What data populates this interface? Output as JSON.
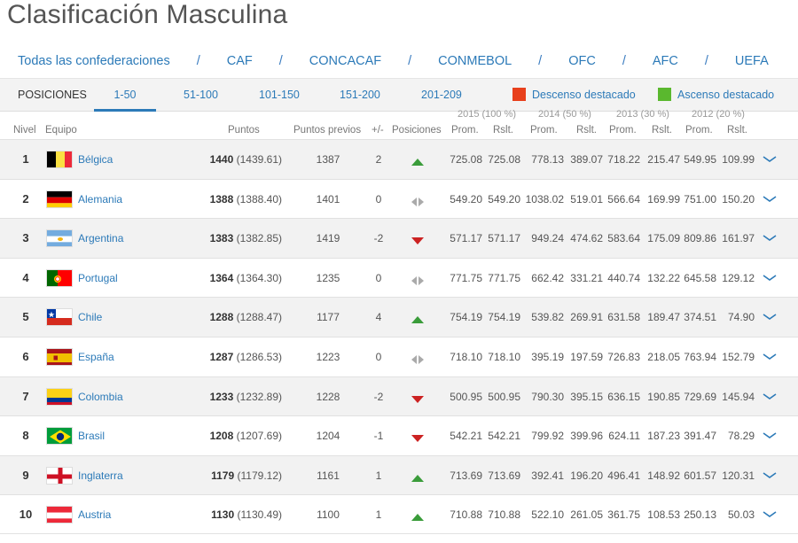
{
  "title": "Clasificación Masculina",
  "confederations": [
    "Todas las confederaciones",
    "CAF",
    "CONCACAF",
    "CONMEBOL",
    "OFC",
    "AFC",
    "UEFA"
  ],
  "confederation_separator": "/",
  "tabs": {
    "label": "POSICIONES",
    "ranges": [
      "1-50",
      "51-100",
      "101-150",
      "151-200",
      "201-209"
    ],
    "active": "1-50"
  },
  "legend": [
    {
      "label": "Descenso destacado",
      "color": "#e8401c"
    },
    {
      "label": "Ascenso destacado",
      "color": "#5ab82e"
    }
  ],
  "colors": {
    "accent": "#2c7ab8",
    "up": "#3a9c3a",
    "down": "#cc2222",
    "same": "#aaaaaa"
  },
  "year_headers": [
    "2015 (100 %)",
    "2014 (50 %)",
    "2013 (30 %)",
    "2012 (20 %)"
  ],
  "columns": {
    "nivel": "Nivel",
    "equipo": "Equipo",
    "puntos": "Puntos",
    "previos": "Puntos previos",
    "diff": "+/-",
    "posiciones": "Posiciones",
    "prom": "Prom.",
    "rslt": "Rslt."
  },
  "rows": [
    {
      "rank": "1",
      "team": "Bélgica",
      "flag": "belgium-flag",
      "pts": "1440",
      "pts_exact": "(1439.61)",
      "prev": "1387",
      "diff": "2",
      "trend": "up",
      "y2015": [
        "725.08",
        "725.08"
      ],
      "y2014": [
        "778.13",
        "389.07"
      ],
      "y2013": [
        "718.22",
        "215.47"
      ],
      "y2012": [
        "549.95",
        "109.99"
      ]
    },
    {
      "rank": "2",
      "team": "Alemania",
      "flag": "germany-flag",
      "pts": "1388",
      "pts_exact": "(1388.40)",
      "prev": "1401",
      "diff": "0",
      "trend": "same",
      "y2015": [
        "549.20",
        "549.20"
      ],
      "y2014": [
        "1038.02",
        "519.01"
      ],
      "y2013": [
        "566.64",
        "169.99"
      ],
      "y2012": [
        "751.00",
        "150.20"
      ]
    },
    {
      "rank": "3",
      "team": "Argentina",
      "flag": "argentina-flag",
      "pts": "1383",
      "pts_exact": "(1382.85)",
      "prev": "1419",
      "diff": "-2",
      "trend": "down",
      "y2015": [
        "571.17",
        "571.17"
      ],
      "y2014": [
        "949.24",
        "474.62"
      ],
      "y2013": [
        "583.64",
        "175.09"
      ],
      "y2012": [
        "809.86",
        "161.97"
      ]
    },
    {
      "rank": "4",
      "team": "Portugal",
      "flag": "portugal-flag",
      "pts": "1364",
      "pts_exact": "(1364.30)",
      "prev": "1235",
      "diff": "0",
      "trend": "same",
      "y2015": [
        "771.75",
        "771.75"
      ],
      "y2014": [
        "662.42",
        "331.21"
      ],
      "y2013": [
        "440.74",
        "132.22"
      ],
      "y2012": [
        "645.58",
        "129.12"
      ]
    },
    {
      "rank": "5",
      "team": "Chile",
      "flag": "chile-flag",
      "pts": "1288",
      "pts_exact": "(1288.47)",
      "prev": "1177",
      "diff": "4",
      "trend": "up",
      "y2015": [
        "754.19",
        "754.19"
      ],
      "y2014": [
        "539.82",
        "269.91"
      ],
      "y2013": [
        "631.58",
        "189.47"
      ],
      "y2012": [
        "374.51",
        "74.90"
      ]
    },
    {
      "rank": "6",
      "team": "España",
      "flag": "spain-flag",
      "pts": "1287",
      "pts_exact": "(1286.53)",
      "prev": "1223",
      "diff": "0",
      "trend": "same",
      "y2015": [
        "718.10",
        "718.10"
      ],
      "y2014": [
        "395.19",
        "197.59"
      ],
      "y2013": [
        "726.83",
        "218.05"
      ],
      "y2012": [
        "763.94",
        "152.79"
      ]
    },
    {
      "rank": "7",
      "team": "Colombia",
      "flag": "colombia-flag",
      "pts": "1233",
      "pts_exact": "(1232.89)",
      "prev": "1228",
      "diff": "-2",
      "trend": "down",
      "y2015": [
        "500.95",
        "500.95"
      ],
      "y2014": [
        "790.30",
        "395.15"
      ],
      "y2013": [
        "636.15",
        "190.85"
      ],
      "y2012": [
        "729.69",
        "145.94"
      ]
    },
    {
      "rank": "8",
      "team": "Brasil",
      "flag": "brazil-flag",
      "pts": "1208",
      "pts_exact": "(1207.69)",
      "prev": "1204",
      "diff": "-1",
      "trend": "down",
      "y2015": [
        "542.21",
        "542.21"
      ],
      "y2014": [
        "799.92",
        "399.96"
      ],
      "y2013": [
        "624.11",
        "187.23"
      ],
      "y2012": [
        "391.47",
        "78.29"
      ]
    },
    {
      "rank": "9",
      "team": "Inglaterra",
      "flag": "england-flag",
      "pts": "1179",
      "pts_exact": "(1179.12)",
      "prev": "1161",
      "diff": "1",
      "trend": "up",
      "y2015": [
        "713.69",
        "713.69"
      ],
      "y2014": [
        "392.41",
        "196.20"
      ],
      "y2013": [
        "496.41",
        "148.92"
      ],
      "y2012": [
        "601.57",
        "120.31"
      ]
    },
    {
      "rank": "10",
      "team": "Austria",
      "flag": "austria-flag",
      "pts": "1130",
      "pts_exact": "(1130.49)",
      "prev": "1100",
      "diff": "1",
      "trend": "up",
      "y2015": [
        "710.88",
        "710.88"
      ],
      "y2014": [
        "522.10",
        "261.05"
      ],
      "y2013": [
        "361.75",
        "108.53"
      ],
      "y2012": [
        "250.13",
        "50.03"
      ]
    }
  ]
}
